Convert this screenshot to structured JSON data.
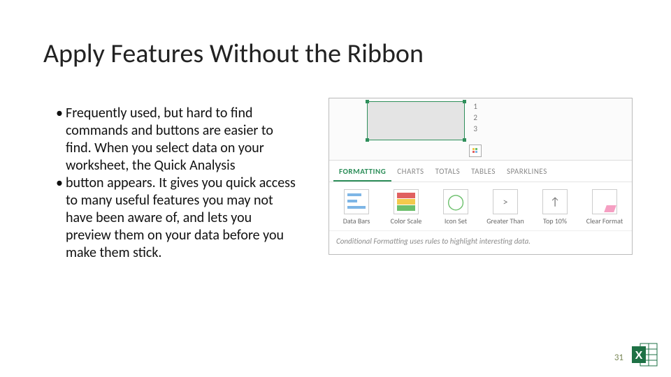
{
  "title": "Apply Features Without the Ribbon",
  "bullets": [
    "Frequently used, but hard to find commands and  buttons are easier to find. When you select data on your worksheet, the Quick Analysis",
    "button appears. It gives you quick access to many useful features you may not have been aware of, and lets you preview them on your data before you make them stick."
  ],
  "quick_analysis": {
    "row_numbers": [
      "1",
      "2",
      "3"
    ],
    "tabs": [
      "FORMATTING",
      "CHARTS",
      "TOTALS",
      "TABLES",
      "SPARKLINES"
    ],
    "active_tab": 0,
    "options": [
      "Data Bars",
      "Color Scale",
      "Icon Set",
      "Greater Than",
      "Top 10%",
      "Clear Format"
    ],
    "hint": "Conditional Formatting uses rules to highlight interesting data."
  },
  "page_number": "31"
}
